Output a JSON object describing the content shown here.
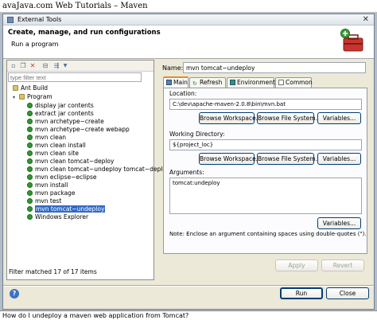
{
  "page_title": "avaJava.com Web Tutorials – Maven",
  "window": {
    "title": "External Tools"
  },
  "header": {
    "title": "Create, manage, and run configurations",
    "subtitle": "Run a program"
  },
  "toolbar": {
    "icons": [
      "new-config-icon",
      "copy-config-icon",
      "delete-config-icon",
      "collapse-all-icon",
      "filter-icon"
    ]
  },
  "filter": {
    "placeholder": "type filter text"
  },
  "tree": {
    "ant_build": "Ant Build",
    "program": "Program",
    "items": [
      "display jar contents",
      "extract jar contents",
      "mvn archetype~create",
      "mvn archetype~create webapp",
      "mvn clean",
      "mvn clean install",
      "mvn clean site",
      "mvn clean tomcat~deploy",
      "mvn clean tomcat~undeploy tomcat~deploy",
      "mvn eclipse~eclipse",
      "mvn install",
      "mvn package",
      "mvn test",
      "mvn tomcat~undeploy",
      "Windows Explorer"
    ],
    "selected": "mvn tomcat~undeploy"
  },
  "status": "Filter matched 17 of 17 items",
  "name": {
    "label": "Name:",
    "value": "mvn tomcat~undeploy"
  },
  "tabs": [
    "Main",
    "Refresh",
    "Environment",
    "Common"
  ],
  "main": {
    "location_label": "Location:",
    "location_value": "C:\\dev\\apache-maven-2.0.8\\bin\\mvn.bat",
    "workdir_label": "Working Directory:",
    "workdir_value": "${project_loc}",
    "arguments_label": "Arguments:",
    "arguments_value": "tomcat:undeploy",
    "browse_workspace": "Browse Workspace...",
    "browse_file_system": "Browse File System...",
    "variables": "Variables...",
    "note": "Note: Enclose an argument containing spaces using double-quotes (\")."
  },
  "buttons": {
    "apply": "Apply",
    "revert": "Revert",
    "run": "Run",
    "close": "Close"
  },
  "caption": "How do I undeploy a maven web application from Tomcat?",
  "colors": {
    "accent": "#316ac5",
    "tab_active": "#e68b2c",
    "program_icon": "#2e9a2e"
  }
}
